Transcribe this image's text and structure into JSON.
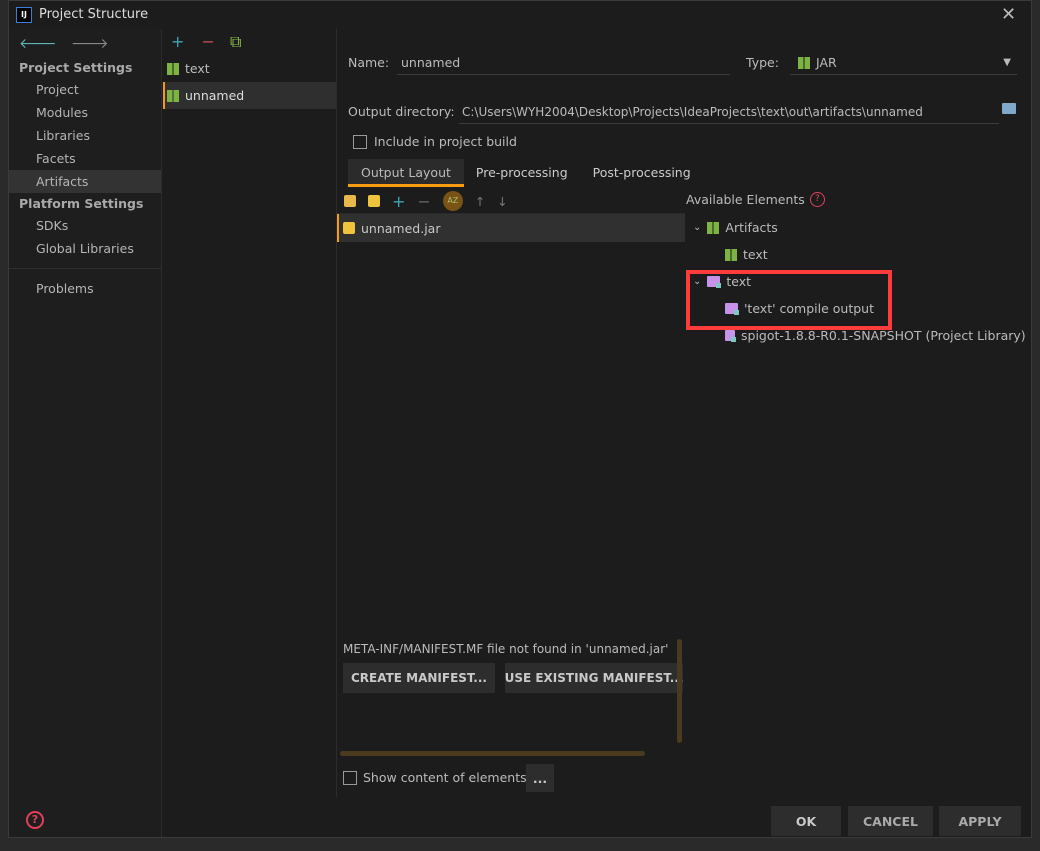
{
  "window": {
    "title": "Project Structure",
    "icon": "IJ"
  },
  "sidebar": {
    "sections": [
      {
        "title": "Project Settings",
        "items": [
          "Project",
          "Modules",
          "Libraries",
          "Facets",
          "Artifacts"
        ]
      },
      {
        "title": "Platform Settings",
        "items": [
          "SDKs",
          "Global Libraries"
        ]
      }
    ],
    "extra": "Problems",
    "selected": "Artifacts"
  },
  "artifacts": {
    "items": [
      "text",
      "unnamed"
    ],
    "selected": "unnamed"
  },
  "form": {
    "name_label": "Name:",
    "name_value": "unnamed",
    "type_label": "Type:",
    "type_value": "JAR",
    "output_label": "Output directory:",
    "output_value": "C:\\Users\\WYH2004\\Desktop\\Projects\\IdeaProjects\\text\\out\\artifacts\\unnamed",
    "include_label": "Include in project build",
    "include_checked": false
  },
  "tabs": [
    "Output Layout",
    "Pre-processing",
    "Post-processing"
  ],
  "active_tab": "Output Layout",
  "layout": {
    "items": [
      "unnamed.jar"
    ],
    "sort_label": "AZ"
  },
  "available": {
    "title": "Available Elements",
    "tree": [
      {
        "label": "Artifacts",
        "expanded": true,
        "children": [
          "text"
        ]
      },
      {
        "label": "text",
        "expanded": true,
        "children": [
          "'text' compile output"
        ]
      },
      {
        "label": "spigot-1.8.8-R0.1-SNAPSHOT (Project Library)"
      }
    ],
    "highlight_color": "#ff3b3b"
  },
  "manifest": {
    "message": "META-INF/MANIFEST.MF file not found in 'unnamed.jar'",
    "create": "CREATE MANIFEST...",
    "use_existing": "USE EXISTING MANIFEST..."
  },
  "show_content": {
    "label": "Show content of elements",
    "checked": false,
    "more": "..."
  },
  "footer": {
    "ok": "OK",
    "cancel": "CANCEL",
    "apply": "APPLY"
  },
  "colors": {
    "accent": "#f99b11",
    "bg": "#1c1c1c"
  }
}
